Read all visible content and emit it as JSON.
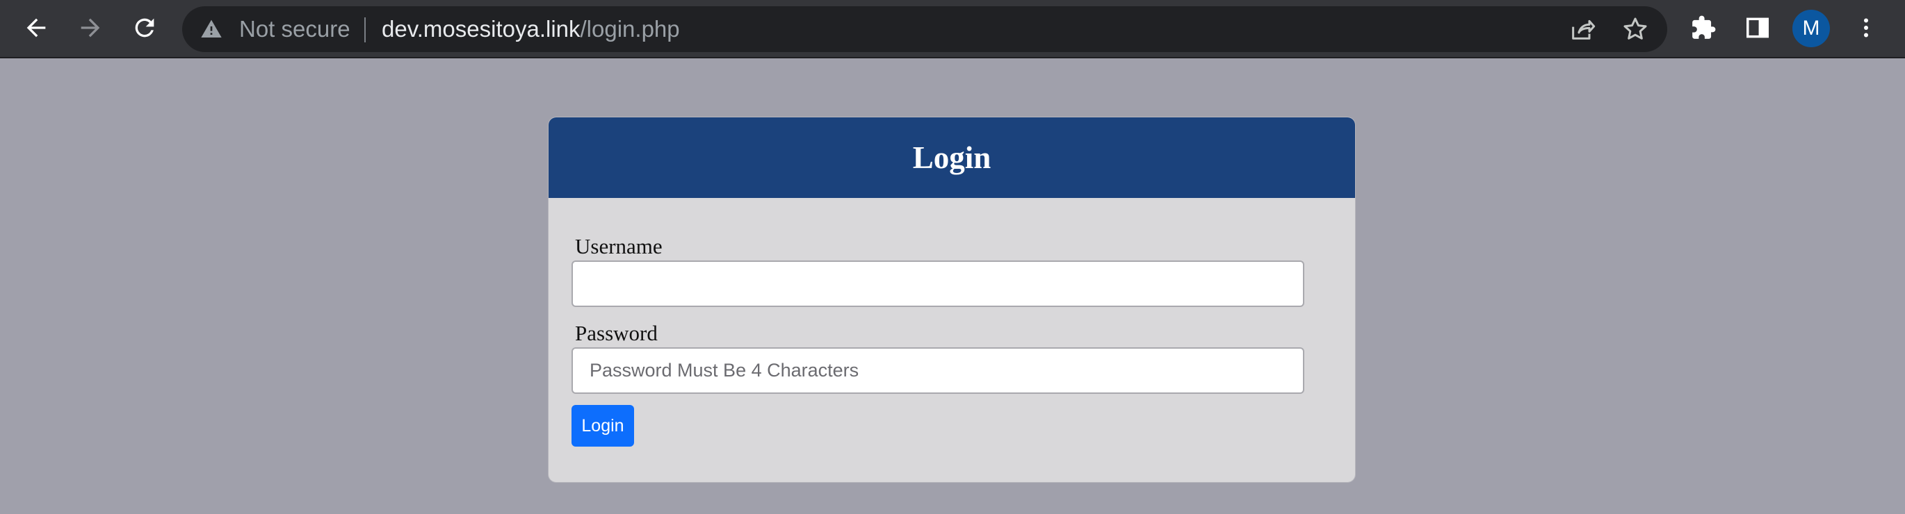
{
  "browser": {
    "security_label": "Not secure",
    "url_host": "dev.mosesitoya.link",
    "url_path": "/login.php",
    "profile_initial": "M",
    "icons": [
      "back-icon",
      "forward-icon",
      "reload-icon",
      "warning-icon",
      "share-icon",
      "star-icon",
      "extensions-icon",
      "side-panel-icon",
      "menu-icon"
    ]
  },
  "login": {
    "title": "Login",
    "username_label": "Username",
    "username_value": "",
    "password_label": "Password",
    "password_placeholder": "Password Must Be 4 Characters",
    "submit_label": "Login"
  },
  "colors": {
    "page_background": "#a0a0ab",
    "header_background": "#1b427c",
    "card_background": "#d9d8da",
    "button_primary": "#0d6efd",
    "avatar_background": "#0b57a0"
  }
}
